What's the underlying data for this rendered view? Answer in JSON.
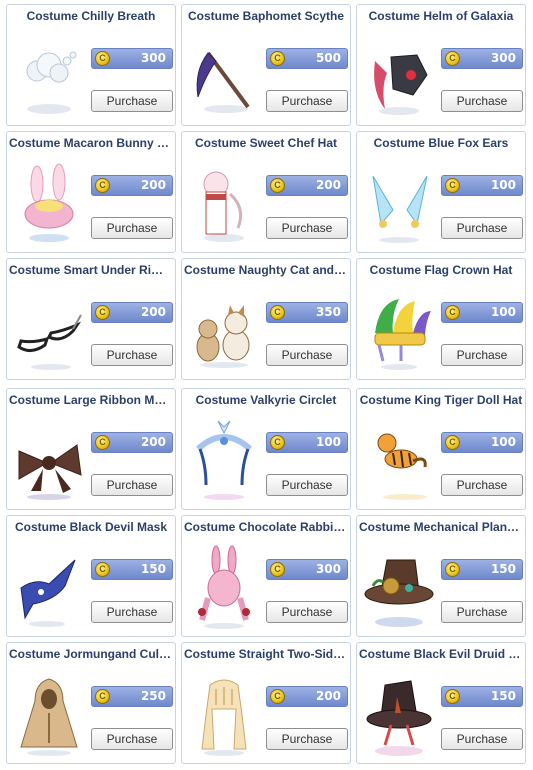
{
  "shop": {
    "button_label": "Purchase",
    "coin_icon": "coin-icon",
    "items": [
      {
        "name": "Costume Chilly Breath",
        "price": "300",
        "icon": "chilly-breath-icon"
      },
      {
        "name": "Costume Baphomet Scythe",
        "price": "500",
        "icon": "scythe-icon"
      },
      {
        "name": "Costume Helm of Galaxia",
        "price": "300",
        "icon": "helm-icon"
      },
      {
        "name": "Costume Macaron Bunny H...",
        "price": "200",
        "icon": "bunny-hat-icon"
      },
      {
        "name": "Costume Sweet Chef Hat",
        "price": "200",
        "icon": "chef-hat-icon"
      },
      {
        "name": "Costume Blue Fox Ears",
        "price": "100",
        "icon": "fox-ears-icon"
      },
      {
        "name": "Costume Smart Under Rim ...",
        "price": "200",
        "icon": "glasses-icon"
      },
      {
        "name": "Costume Naughty Cat and D...",
        "price": "350",
        "icon": "cat-dog-icon"
      },
      {
        "name": "Costume Flag Crown Hat",
        "price": "100",
        "icon": "jester-hat-icon"
      },
      {
        "name": "Costume Large Ribbon Muff...",
        "price": "200",
        "icon": "ribbon-muffler-icon"
      },
      {
        "name": "Costume Valkyrie Circlet",
        "price": "100",
        "icon": "circlet-icon"
      },
      {
        "name": "Costume King Tiger Doll Hat",
        "price": "100",
        "icon": "tiger-doll-icon"
      },
      {
        "name": "Costume Black Devil Mask",
        "price": "150",
        "icon": "devil-mask-icon"
      },
      {
        "name": "Costume Chocolate Rabbit ...",
        "price": "300",
        "icon": "rabbit-icon"
      },
      {
        "name": "Costume Mechanical Plant ...",
        "price": "150",
        "icon": "mechanical-hat-icon"
      },
      {
        "name": "Costume Jormungand Cult ...",
        "price": "250",
        "icon": "cult-robe-icon"
      },
      {
        "name": "Costume Straight Two-Side ...",
        "price": "200",
        "icon": "hair-icon"
      },
      {
        "name": "Costume Black Evil Druid Hat",
        "price": "150",
        "icon": "druid-hat-icon"
      }
    ]
  }
}
